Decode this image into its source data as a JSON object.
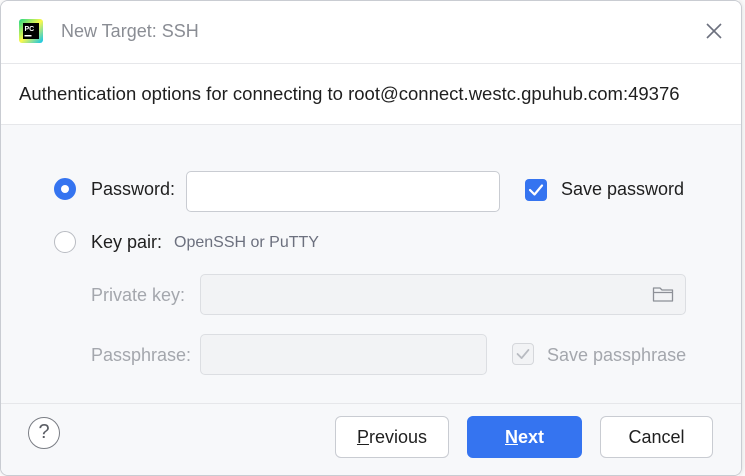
{
  "window": {
    "title": "New Target: SSH",
    "app_icon_text": "PC"
  },
  "header": {
    "subtitle": "Authentication options for connecting to root@connect.westc.gpuhub.com:49376"
  },
  "auth": {
    "password_option": {
      "label": "Password:",
      "selected": true
    },
    "password_value": "",
    "save_password": {
      "label": "Save password",
      "checked": true
    },
    "keypair_option": {
      "label": "Key pair:",
      "selected": false,
      "hint": "OpenSSH or PuTTY"
    },
    "private_key": {
      "label": "Private key:",
      "value": ""
    },
    "passphrase": {
      "label": "Passphrase:",
      "value": ""
    },
    "save_passphrase": {
      "label": "Save passphrase",
      "checked": true,
      "enabled": false
    }
  },
  "footer": {
    "previous": {
      "mnemonic": "P",
      "rest": "revious"
    },
    "next": {
      "mnemonic": "N",
      "rest": "ext"
    },
    "cancel": "Cancel",
    "help": "?"
  },
  "colors": {
    "accent": "#3574f0",
    "dialog_bg": "#f7f8fa",
    "disabled_text": "#a4a7ad"
  },
  "icons": [
    "pycharm-app-icon",
    "close-icon",
    "folder-icon",
    "checkmark-icon",
    "help-icon"
  ]
}
